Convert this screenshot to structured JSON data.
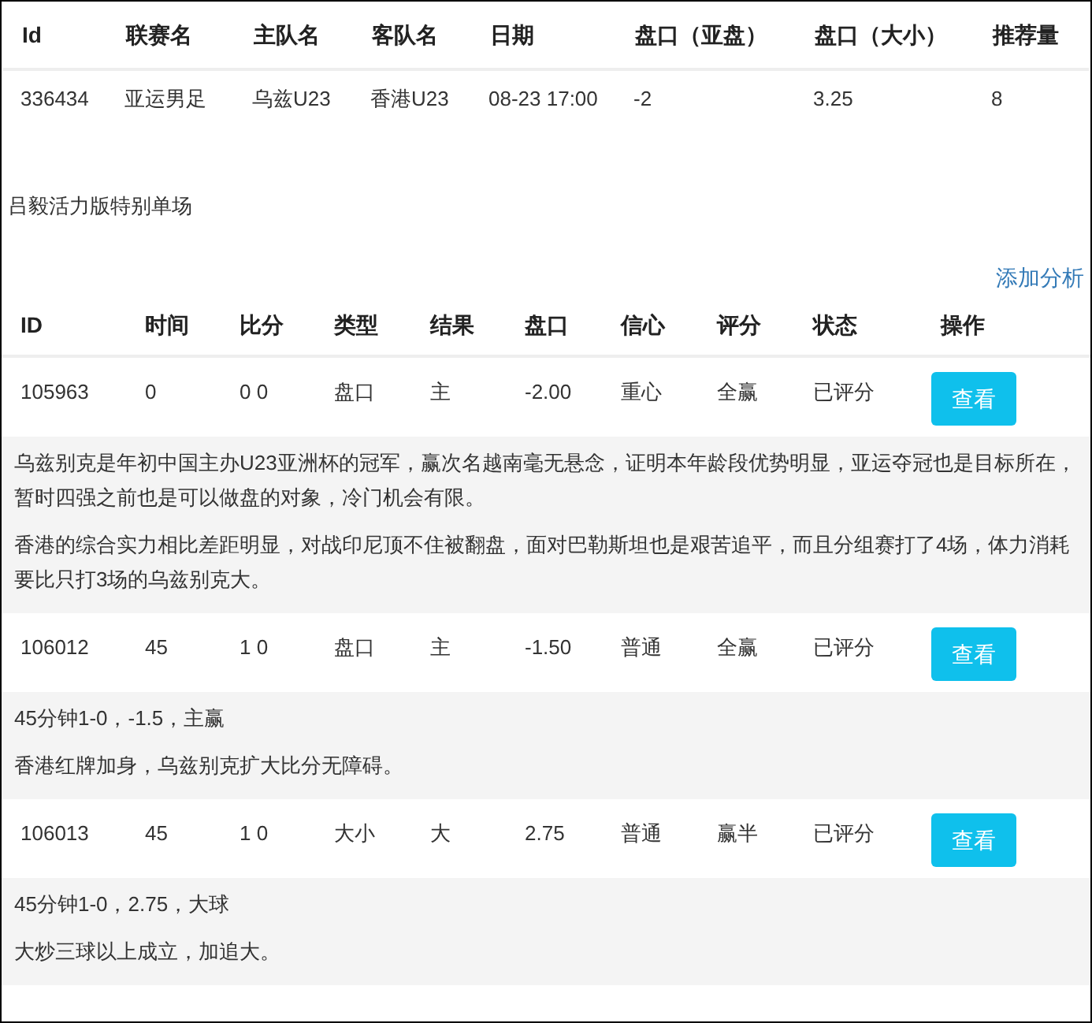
{
  "match_table": {
    "columns": [
      "Id",
      "联赛名",
      "主队名",
      "客队名",
      "日期",
      "盘口（亚盘）",
      "盘口（大小）",
      "推荐量"
    ],
    "rows": [
      [
        "336434",
        "亚运男足",
        "乌兹U23",
        "香港U23",
        "08-23 17:00",
        "-2",
        "3.25",
        "8"
      ]
    ]
  },
  "section_title": "吕毅活力版特别单场",
  "add_analysis_link": "添加分析",
  "analysis_table": {
    "columns": [
      "ID",
      "时间",
      "比分",
      "类型",
      "结果",
      "盘口",
      "信心",
      "评分",
      "状态",
      "操作"
    ],
    "rows": [
      {
        "cells": [
          "105963",
          "0",
          "0 0",
          "盘口",
          "主",
          "-2.00",
          "重心",
          "全赢",
          "已评分"
        ],
        "button": "查看",
        "notes": [
          "乌兹别克是年初中国主办U23亚洲杯的冠军，赢次名越南毫无悬念，证明本年龄段优势明显，亚运夺冠也是目标所在，暂时四强之前也是可以做盘的对象，冷门机会有限。",
          "香港的综合实力相比差距明显，对战印尼顶不住被翻盘，面对巴勒斯坦也是艰苦追平，而且分组赛打了4场，体力消耗要比只打3场的乌兹别克大。"
        ]
      },
      {
        "cells": [
          "106012",
          "45",
          "1 0",
          "盘口",
          "主",
          "-1.50",
          "普通",
          "全赢",
          "已评分"
        ],
        "button": "查看",
        "notes": [
          "45分钟1-0，-1.5，主赢",
          "香港红牌加身，乌兹别克扩大比分无障碍。"
        ]
      },
      {
        "cells": [
          "106013",
          "45",
          "1 0",
          "大小",
          "大",
          "2.75",
          "普通",
          "赢半",
          "已评分"
        ],
        "button": "查看",
        "notes": [
          "45分钟1-0，2.75，大球",
          "大炒三球以上成立，加追大。"
        ]
      }
    ]
  }
}
